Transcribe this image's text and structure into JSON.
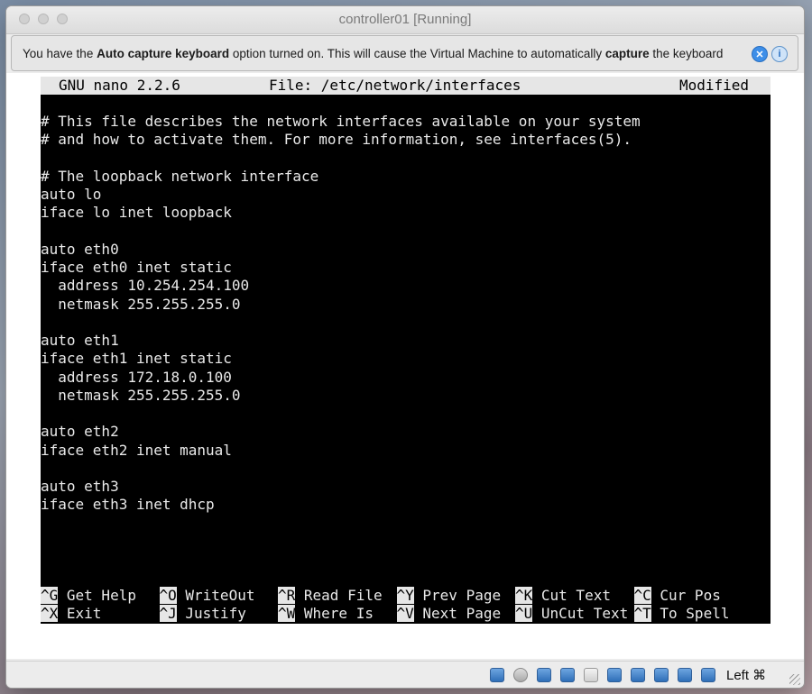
{
  "window": {
    "title": "controller01 [Running]"
  },
  "banner": {
    "text_1": "You have the ",
    "bold_1": "Auto capture keyboard",
    "text_2": " option turned on. This will cause the Virtual Machine to automatically ",
    "bold_2": "capture",
    "text_3": " the keyboard"
  },
  "nano": {
    "version": "GNU nano 2.2.6",
    "file": "File: /etc/network/interfaces",
    "status": "Modified",
    "lines": [
      "# This file describes the network interfaces available on your system",
      "# and how to activate them. For more information, see interfaces(5).",
      "",
      "# The loopback network interface",
      "auto lo",
      "iface lo inet loopback",
      "",
      "auto eth0",
      "iface eth0 inet static",
      "  address 10.254.254.100",
      "  netmask 255.255.255.0",
      "",
      "auto eth1",
      "iface eth1 inet static",
      "  address 172.18.0.100",
      "  netmask 255.255.255.0",
      "",
      "auto eth2",
      "iface eth2 inet manual",
      "",
      "auto eth3",
      "iface eth3 inet dhcp"
    ],
    "shortcuts_row1": [
      {
        "key": "^G",
        "label": " Get Help"
      },
      {
        "key": "^O",
        "label": " WriteOut"
      },
      {
        "key": "^R",
        "label": " Read File"
      },
      {
        "key": "^Y",
        "label": " Prev Page"
      },
      {
        "key": "^K",
        "label": " Cut Text"
      },
      {
        "key": "^C",
        "label": " Cur Pos"
      }
    ],
    "shortcuts_row2": [
      {
        "key": "^X",
        "label": " Exit"
      },
      {
        "key": "^J",
        "label": " Justify"
      },
      {
        "key": "^W",
        "label": " Where Is"
      },
      {
        "key": "^V",
        "label": " Next Page"
      },
      {
        "key": "^U",
        "label": " UnCut Text"
      },
      {
        "key": "^T",
        "label": " To Spell"
      }
    ]
  },
  "statusbar": {
    "icons": [
      "hard-disk-icon",
      "optical-drive-icon",
      "audio-icon",
      "usb-icon",
      "shared-folders-icon",
      "display-icon",
      "video-capture-icon",
      "cpu-icon",
      "network-icon",
      "mouse-integration-icon"
    ],
    "host_key": "Left ⌘"
  },
  "colors": {
    "console_bg": "#000000",
    "console_fg": "#e9e9e9",
    "inverse_bg": "#e6e6e6"
  }
}
